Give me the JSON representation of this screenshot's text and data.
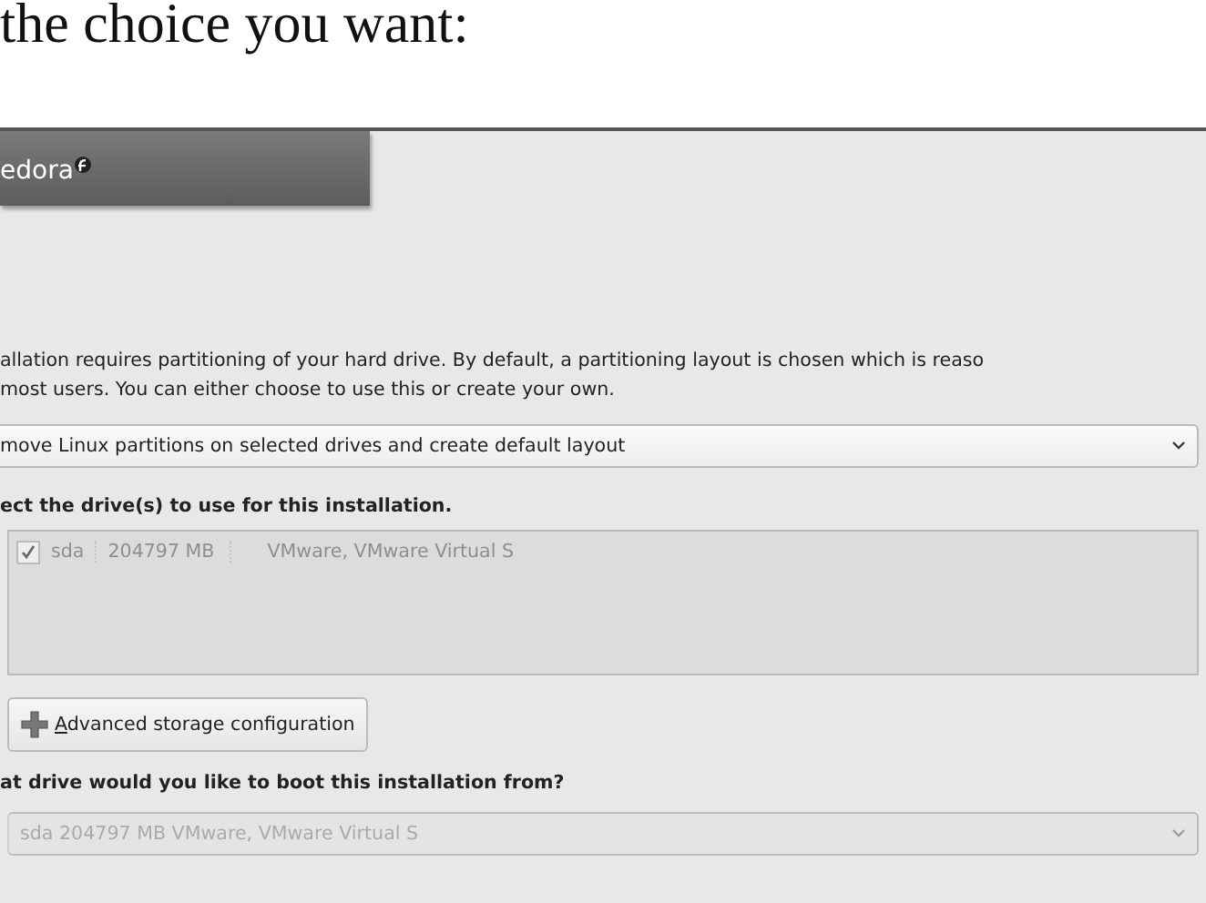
{
  "document_text": "the choice you want:",
  "banner": {
    "logo_text": "edora"
  },
  "description_lines": [
    "allation requires partitioning of your hard drive.  By default, a partitioning layout is chosen which is reaso",
    "most users.  You can either choose to use this or create your own."
  ],
  "layout_dropdown": {
    "value": "move Linux partitions on selected drives and create default layout",
    "disabled": false
  },
  "drives_heading": "ect the drive(s) to use for this installation.",
  "drives": [
    {
      "checked": true,
      "disabled": true,
      "name": "sda",
      "size": "204797 MB",
      "model": "VMware, VMware Virtual S"
    }
  ],
  "advanced_button": {
    "access_key": "A",
    "label": "dvanced storage configuration"
  },
  "boot_heading": "at drive would you like to boot this installation from?",
  "boot_dropdown": {
    "value": "sda   204797 MB VMware, VMware Virtual S",
    "disabled": true
  }
}
